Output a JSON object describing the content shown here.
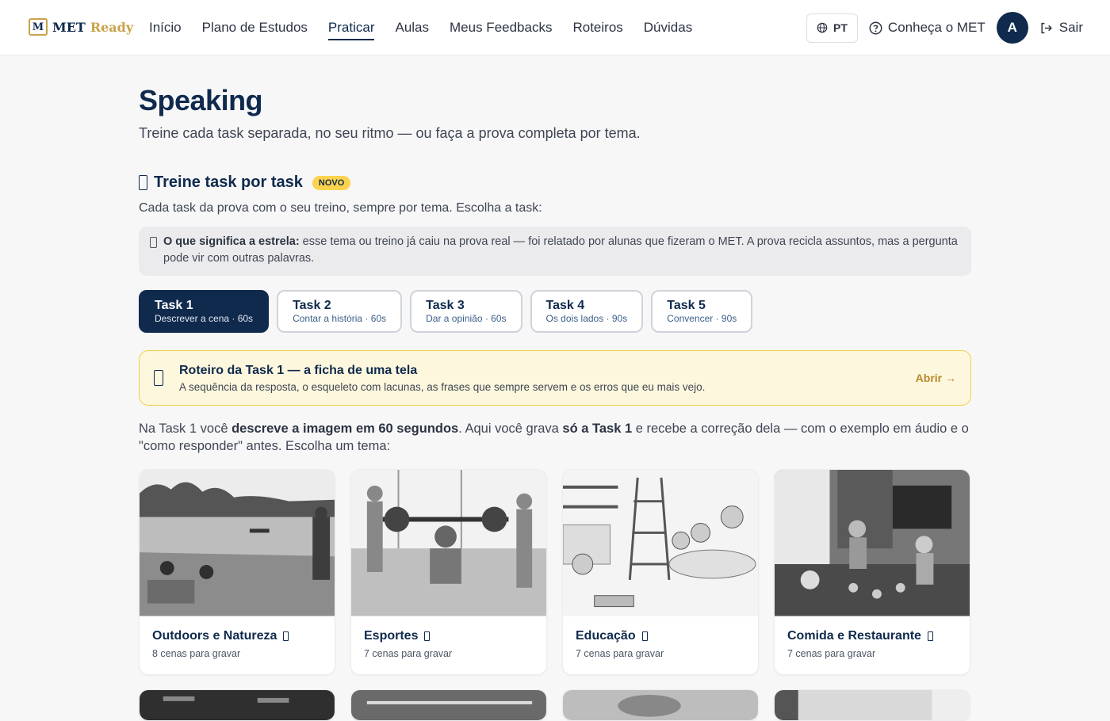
{
  "brand": {
    "mark": "M",
    "name_a": "MET",
    "name_b": "Ready"
  },
  "nav": [
    {
      "label": "Início"
    },
    {
      "label": "Plano de Estudos"
    },
    {
      "label": "Praticar"
    },
    {
      "label": "Aulas"
    },
    {
      "label": "Meus Feedbacks"
    },
    {
      "label": "Roteiros"
    },
    {
      "label": "Dúvidas"
    }
  ],
  "header_right": {
    "lang": "PT",
    "about": "Conheça o MET",
    "avatar": "A",
    "logout": "Sair"
  },
  "page": {
    "title": "Speaking",
    "subtitle": "Treine cada task separada, no seu ritmo — ou faça a prova completa por tema."
  },
  "section": {
    "title": "Treine task por task",
    "badge": "NOVO",
    "desc": "Cada task da prova com o seu treino, sempre por tema. Escolha a task:",
    "info_bold": "O que significa a estrela:",
    "info_text": " esse tema ou treino já caiu na prova real — foi relatado por alunas que fizeram o MET. A prova recicla assuntos, mas a pergunta pode vir com outras palavras."
  },
  "tasks": [
    {
      "name": "Task 1",
      "desc": "Descrever a cena · 60s",
      "active": true
    },
    {
      "name": "Task 2",
      "desc": "Contar a história · 60s"
    },
    {
      "name": "Task 3",
      "desc": "Dar a opinião · 60s"
    },
    {
      "name": "Task 4",
      "desc": "Os dois lados · 90s"
    },
    {
      "name": "Task 5",
      "desc": "Convencer · 90s"
    }
  ],
  "roteiro": {
    "title": "Roteiro da Task 1 — a ficha de uma tela",
    "desc": "A sequência da resposta, o esqueleto com lacunas, as frases que sempre servem e os erros que eu mais vejo.",
    "open": "Abrir →"
  },
  "intro": {
    "p1": "Na Task 1 você ",
    "b1": "descreve a imagem em 60 segundos",
    "p2": ". Aqui você grava ",
    "b2": "só a Task 1",
    "p3": " e recebe a correção dela — com o exemplo em áudio e o \"como responder\" antes. Escolha um tema:"
  },
  "themes": [
    {
      "title": "Outdoors e Natureza",
      "meta": "8 cenas para gravar"
    },
    {
      "title": "Esportes",
      "meta": "7 cenas para gravar"
    },
    {
      "title": "Educação",
      "meta": "7 cenas para gravar"
    },
    {
      "title": "Comida e Restaurante",
      "meta": "7 cenas para gravar"
    }
  ],
  "colors": {
    "navy": "#0f2a4d",
    "gold": "#c9a24a",
    "yellow_badge": "#fbd34d",
    "roteiro_bg": "#fdf7dd"
  }
}
